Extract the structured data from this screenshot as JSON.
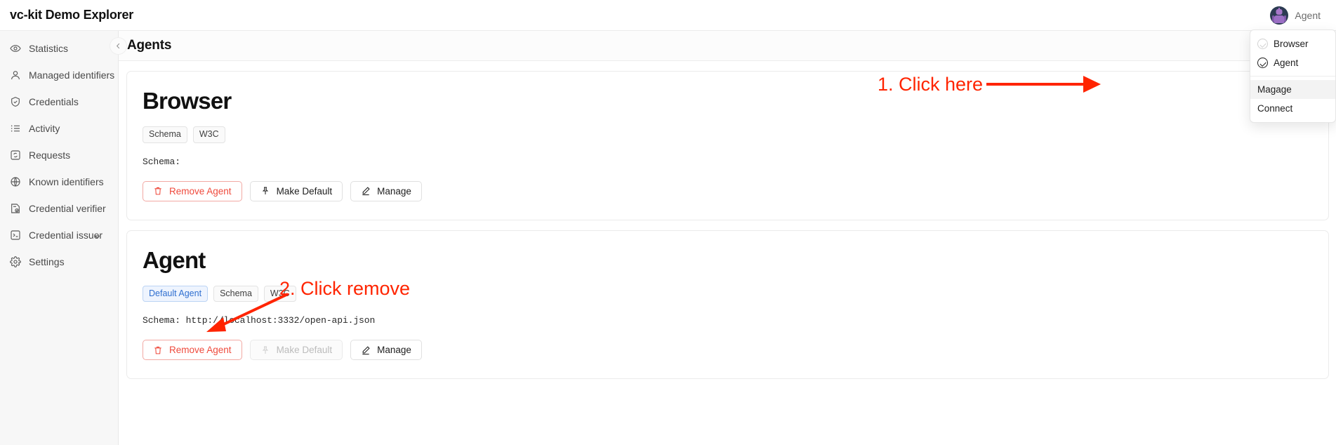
{
  "app": {
    "brand": "vc-kit Demo Explorer"
  },
  "user": {
    "name": "Agent",
    "avatar_icon": "robot-avatar-icon"
  },
  "dropdown": {
    "items": [
      {
        "label": "Browser",
        "icon": "check-circle-icon",
        "checked": false,
        "highlight": false
      },
      {
        "label": "Agent",
        "icon": "check-circle-icon",
        "checked": true,
        "highlight": false
      },
      {
        "label": "Magage",
        "icon": "",
        "checked": false,
        "highlight": true
      },
      {
        "label": "Connect",
        "icon": "",
        "checked": false,
        "highlight": false
      }
    ]
  },
  "sidebar": {
    "items": [
      {
        "label": "Statistics",
        "icon": "eye-icon"
      },
      {
        "label": "Managed identifiers",
        "icon": "user-icon"
      },
      {
        "label": "Credentials",
        "icon": "shield-check-icon"
      },
      {
        "label": "Activity",
        "icon": "list-icon"
      },
      {
        "label": "Requests",
        "icon": "box-refresh-icon"
      },
      {
        "label": "Known identifiers",
        "icon": "globe-icon"
      },
      {
        "label": "Credential verifier",
        "icon": "document-check-icon"
      },
      {
        "label": "Credential issuer",
        "icon": "terminal-icon",
        "caret": "chevron-down-icon"
      },
      {
        "label": "Settings",
        "icon": "gear-icon"
      }
    ]
  },
  "page": {
    "title": "Agents",
    "collapse_icon": "chevron-left-icon"
  },
  "cards": [
    {
      "title": "Browser",
      "tags": [
        {
          "label": "Schema",
          "style": "default"
        },
        {
          "label": "W3C",
          "style": "default"
        }
      ],
      "schema": "Schema:",
      "buttons": [
        {
          "label": "Remove Agent",
          "icon": "trash-icon",
          "style": "danger",
          "disabled": false
        },
        {
          "label": "Make Default",
          "icon": "pin-icon",
          "style": "default",
          "disabled": false
        },
        {
          "label": "Manage",
          "icon": "pencil-icon",
          "style": "default",
          "disabled": false
        }
      ]
    },
    {
      "title": "Agent",
      "tags": [
        {
          "label": "Default Agent",
          "style": "blue"
        },
        {
          "label": "Schema",
          "style": "default"
        },
        {
          "label": "W3C",
          "style": "default"
        }
      ],
      "schema": "Schema: http://localhost:3332/open-api.json",
      "buttons": [
        {
          "label": "Remove Agent",
          "icon": "trash-icon",
          "style": "danger",
          "disabled": false
        },
        {
          "label": "Make Default",
          "icon": "pin-icon",
          "style": "default",
          "disabled": true
        },
        {
          "label": "Manage",
          "icon": "pencil-icon",
          "style": "default",
          "disabled": false
        }
      ]
    }
  ],
  "annotations": [
    {
      "text": "1. Click here",
      "color": "#ff2400"
    },
    {
      "text": "2. Click remove",
      "color": "#ff2400"
    }
  ]
}
